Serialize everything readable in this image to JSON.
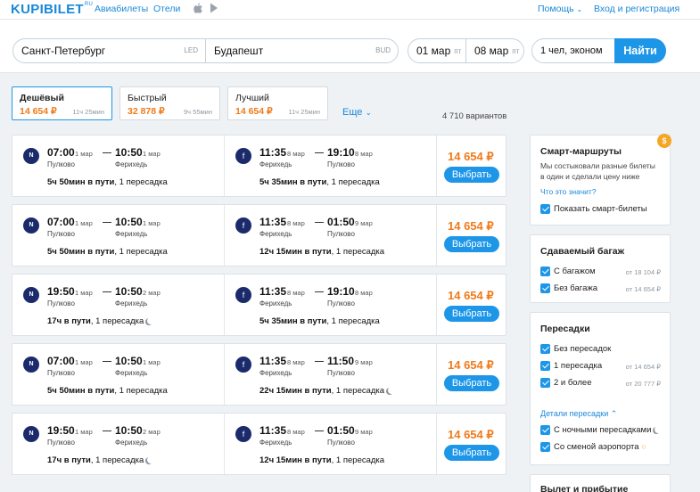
{
  "nav": {
    "logo": "KUPIBILET",
    "logo_suffix": "RU",
    "links": [
      "Авиабилеты",
      "Отели"
    ],
    "help": "Помощь",
    "login": "Вход и регистрация"
  },
  "search": {
    "from": "Санкт-Петербург",
    "from_code": "LED",
    "to": "Будапешт",
    "to_code": "BUD",
    "date_out": "01 мар",
    "date_out_wd": "пт",
    "date_back": "08 мар",
    "date_back_wd": "пт",
    "passengers": "1 чел, эконом",
    "submit": "Найти"
  },
  "sort_tabs": [
    {
      "title": "Дешёвый",
      "price": "14 654 ₽",
      "duration": "11ч 25мин"
    },
    {
      "title": "Быстрый",
      "price": "32 878 ₽",
      "duration": "9ч 55мин"
    },
    {
      "title": "Лучший",
      "price": "14 654 ₽",
      "duration": "11ч 25мин"
    }
  ],
  "more_label": "Еще",
  "variants_count": "4 710 вариантов",
  "results": [
    {
      "out": {
        "dep_time": "07:00",
        "dep_date": "1 мар",
        "dep_ap": "Пулково",
        "arr_time": "10:50",
        "arr_date": "1 мар",
        "arr_ap": "Ферихедь",
        "duration": "5ч 50мин в пути",
        "stops": ", 1 пересадка"
      },
      "back": {
        "dep_time": "11:35",
        "dep_date": "8 мар",
        "dep_ap": "Ферихедь",
        "arr_time": "19:10",
        "arr_date": "8 мар",
        "arr_ap": "Пулково",
        "duration": "5ч 35мин в пути",
        "stops": ", 1 пересадка"
      },
      "price": "14 654 ₽",
      "button": "Выбрать"
    },
    {
      "out": {
        "dep_time": "07:00",
        "dep_date": "1 мар",
        "dep_ap": "Пулково",
        "arr_time": "10:50",
        "arr_date": "1 мар",
        "arr_ap": "Ферихедь",
        "duration": "5ч 50мин в пути",
        "stops": ", 1 пересадка"
      },
      "back": {
        "dep_time": "11:35",
        "dep_date": "8 мар",
        "dep_ap": "Ферихедь",
        "arr_time": "01:50",
        "arr_date": "9 мар",
        "arr_ap": "Пулково",
        "duration": "12ч 15мин в пути",
        "stops": ", 1 пересадка"
      },
      "price": "14 654 ₽",
      "button": "Выбрать"
    },
    {
      "out": {
        "dep_time": "19:50",
        "dep_date": "1 мар",
        "dep_ap": "Пулково",
        "arr_time": "10:50",
        "arr_date": "2 мар",
        "arr_ap": "Ферихедь",
        "duration": "17ч в пути",
        "stops": ", 1 пересадка"
      },
      "back": {
        "dep_time": "11:35",
        "dep_date": "8 мар",
        "dep_ap": "Ферихедь",
        "arr_time": "19:10",
        "arr_date": "8 мар",
        "arr_ap": "Пулково",
        "duration": "5ч 35мин в пути",
        "stops": ", 1 пересадка"
      },
      "price": "14 654 ₽",
      "button": "Выбрать"
    },
    {
      "out": {
        "dep_time": "07:00",
        "dep_date": "1 мар",
        "dep_ap": "Пулково",
        "arr_time": "10:50",
        "arr_date": "1 мар",
        "arr_ap": "Ферихедь",
        "duration": "5ч 50мин в пути",
        "stops": ", 1 пересадка"
      },
      "back": {
        "dep_time": "11:35",
        "dep_date": "8 мар",
        "dep_ap": "Ферихедь",
        "arr_time": "11:50",
        "arr_date": "9 мар",
        "arr_ap": "Пулково",
        "duration": "22ч 15мин в пути",
        "stops": ", 1 пересадка"
      },
      "price": "14 654 ₽",
      "button": "Выбрать"
    },
    {
      "out": {
        "dep_time": "19:50",
        "dep_date": "1 мар",
        "dep_ap": "Пулково",
        "arr_time": "10:50",
        "arr_date": "2 мар",
        "arr_ap": "Ферихедь",
        "duration": "17ч в пути",
        "stops": ", 1 пересадка"
      },
      "back": {
        "dep_time": "11:35",
        "dep_date": "8 мар",
        "dep_ap": "Ферихедь",
        "arr_time": "01:50",
        "arr_date": "9 мар",
        "arr_ap": "Пулково",
        "duration": "12ч 15мин в пути",
        "stops": ", 1 пересадка"
      },
      "price": "14 654 ₽",
      "button": "Выбрать"
    }
  ],
  "sidebar": {
    "smart": {
      "title": "Смарт-маршруты",
      "text": "Мы состыковали разные билеты в один и сделали цену ниже",
      "link": "Что это значит?",
      "checkbox": "Показать смарт-билеты"
    },
    "baggage": {
      "title": "Сдаваемый багаж",
      "options": [
        {
          "label": "С багажом",
          "price": "от 18 104 ₽"
        },
        {
          "label": "Без багажа",
          "price": "от 14 654 ₽"
        }
      ]
    },
    "transfers": {
      "title": "Пересадки",
      "options": [
        {
          "label": "Без пересадок",
          "price": ""
        },
        {
          "label": "1 пересадка",
          "price": "от 14 654 ₽"
        },
        {
          "label": "2 и более",
          "price": "от 20 777 ₽"
        }
      ],
      "details_link": "Детали пересадки",
      "extra": [
        {
          "label": "С ночными пересадками"
        },
        {
          "label": "Со сменой аэропорта"
        }
      ]
    },
    "next_title": "Вылет и прибытие"
  },
  "colors": {
    "accent": "#1e96e8",
    "price": "#f07a1a"
  }
}
